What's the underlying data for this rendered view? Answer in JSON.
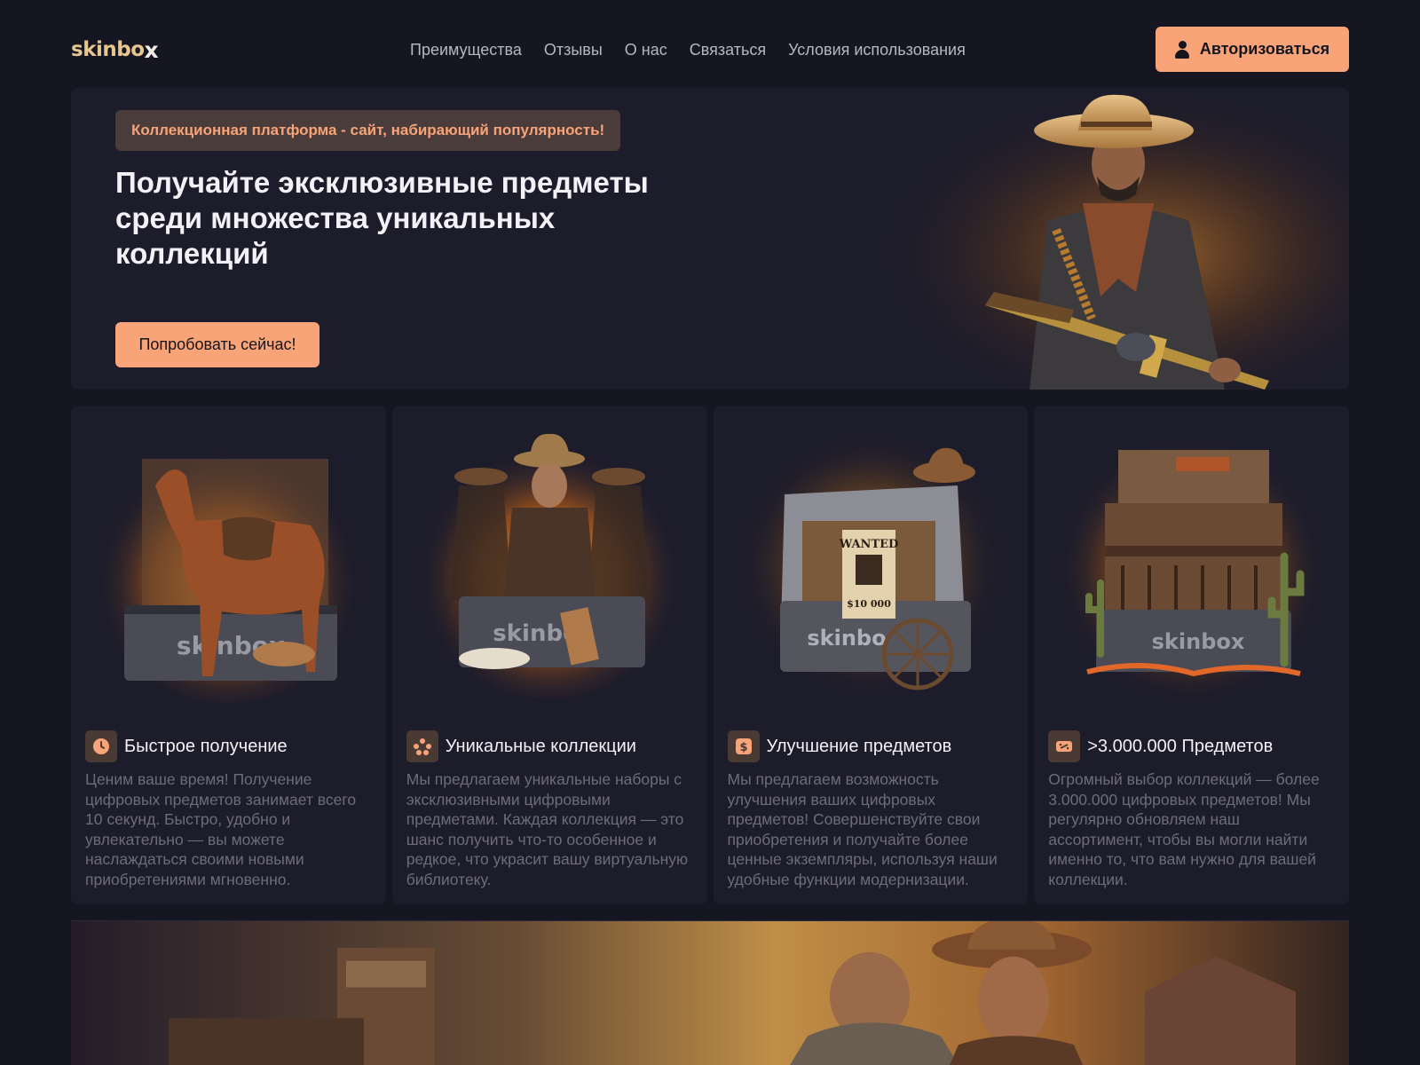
{
  "header": {
    "logo_main": "skinbo",
    "logo_x": "x",
    "nav": [
      {
        "label": "Преимущества"
      },
      {
        "label": "Отзывы"
      },
      {
        "label": "О нас"
      },
      {
        "label": "Связаться"
      },
      {
        "label": "Условия использования"
      }
    ],
    "auth_label": "Авторизоваться"
  },
  "hero": {
    "badge": "Коллекционная платформа - сайт, набирающий популярность!",
    "title": "Получайте эксклюзивные предметы среди множества уникальных коллекций",
    "cta": "Попробовать сейчас!"
  },
  "features": [
    {
      "icon": "clock-icon",
      "title": "Быстрое получение",
      "text": "Ценим ваше время! Получение цифровых предметов занимает всего 10 секунд. Быстро, удобно и увлекательно — вы можете наслаждаться своими новыми приобретениями мгновенно."
    },
    {
      "icon": "cluster-icon",
      "title": "Уникальные коллекции",
      "text": "Мы предлагаем уникальные наборы с эксклюзивными цифровыми предметами. Каждая коллекция — это шанс получить что-то особенное и редкое, что украсит вашу виртуальную библиотеку."
    },
    {
      "icon": "dollar-icon",
      "title": "Улучшение предметов",
      "text": "Мы предлагаем возможность улучшения ваших цифровых предметов! Совершенствуйте свои приобретения и получайте более ценные экземпляры, используя наши удобные функции модернизации."
    },
    {
      "icon": "ticket-icon",
      "title": ">3.000.000 Предметов",
      "text": "Огромный выбор коллекций — более 3.000.000 цифровых предметов! Мы регулярно обновляем наш ассортимент, чтобы вы могли найти именно то, что вам нужно для вашей коллекции."
    }
  ],
  "colors": {
    "accent": "#f9a478",
    "background": "#161622",
    "card": "#1d1c2b",
    "muted_text": "#6d6c7b"
  }
}
